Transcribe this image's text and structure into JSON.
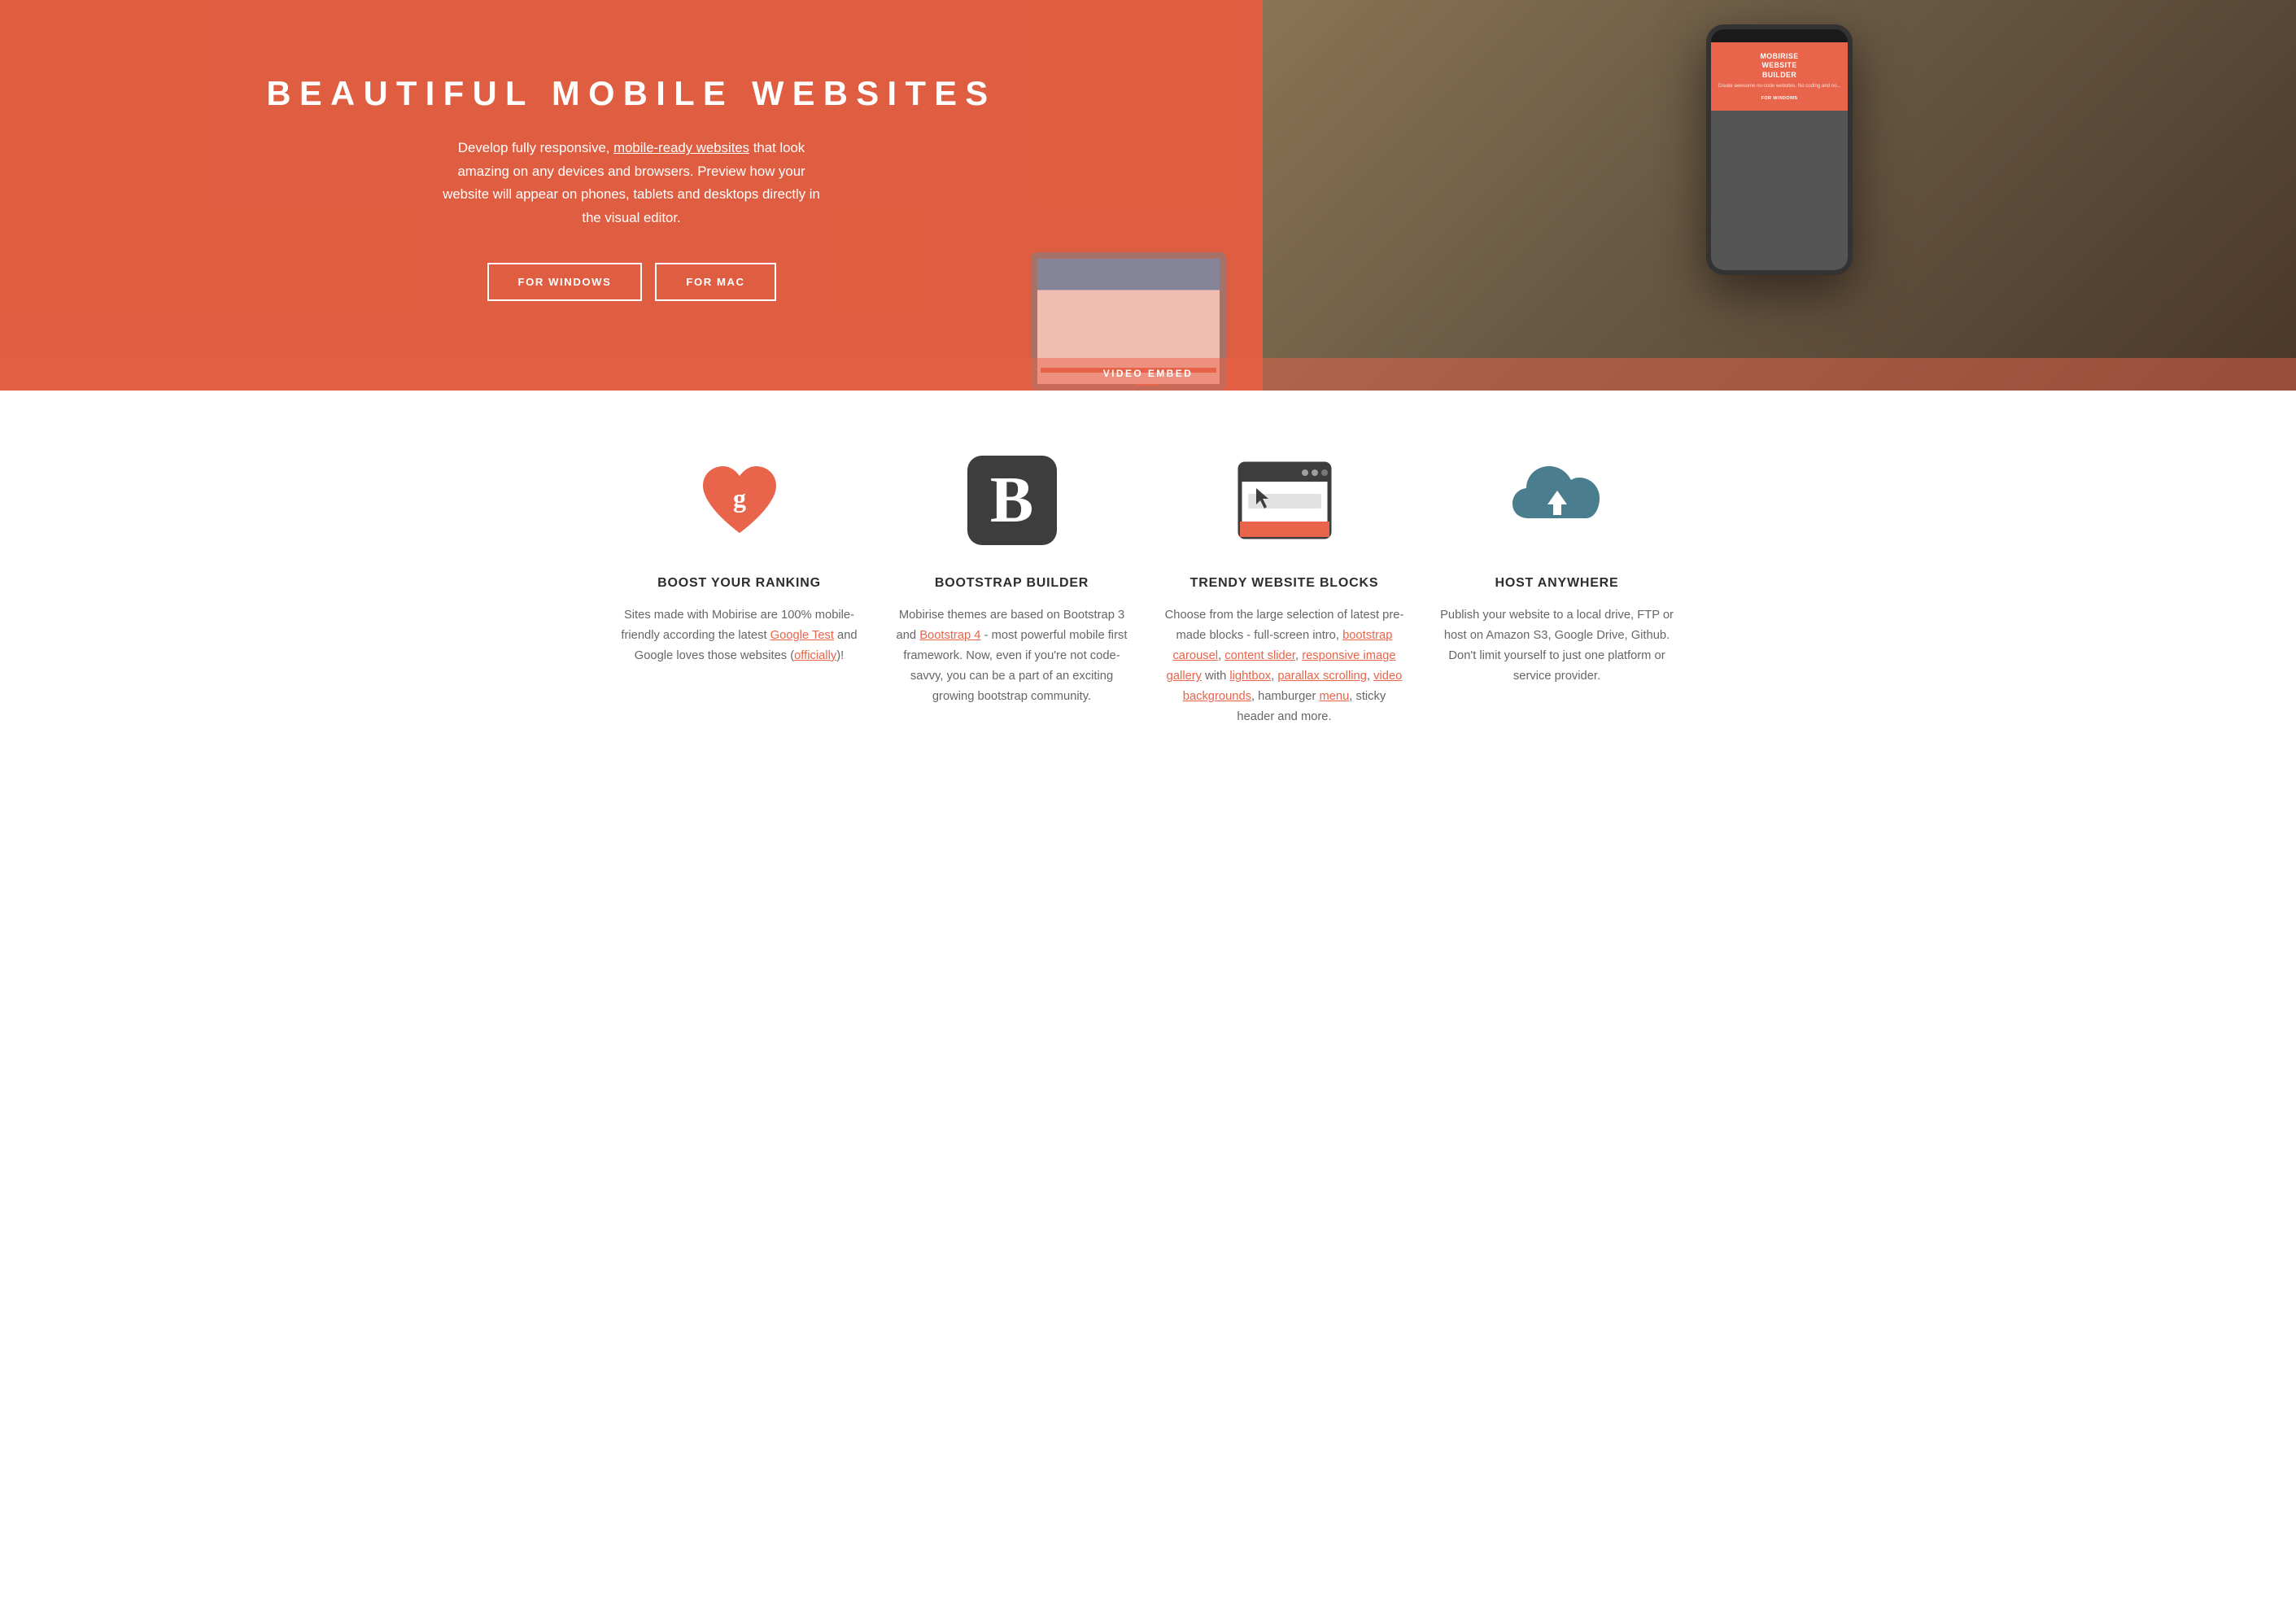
{
  "hero": {
    "title": "BEAUTIFUL MOBILE WEBSITES",
    "description_parts": [
      "Develop fully responsive, ",
      "mobile-ready websites",
      " that look amazing on any devices and browsers. Preview how your website will appear on phones, tablets and desktops directly in the visual editor."
    ],
    "description_link_text": "mobile-ready websites",
    "btn_windows": "FOR WINDOWS",
    "btn_mac": "FOR MAC",
    "phone_title": "MOBIRISE\nWEBSITE\nBUILDER",
    "phone_sub": "Create awesome no-code websites. No coding and no...",
    "phone_btn": "FOR WINDOWS",
    "video_label": "VIDEO EMBED"
  },
  "features": [
    {
      "icon": "heart-google",
      "title": "BOOST YOUR RANKING",
      "description_html": "Sites made with Mobirise are 100% mobile-friendly according the latest <u>Google Test</u> and Google loves those websites (<u>officially</u>)!"
    },
    {
      "icon": "bootstrap-b",
      "title": "BOOTSTRAP BUILDER",
      "description_html": "Mobirise themes are based on Bootstrap 3 and <u>Bootstrap 4</u> - most powerful mobile first framework. Now, even if you're not code-savvy, you can be a part of an exciting growing bootstrap community."
    },
    {
      "icon": "browser-window",
      "title": "TRENDY WEBSITE BLOCKS",
      "description_html": "Choose from the large selection of latest pre-made blocks - full-screen intro, <u>bootstrap carousel</u>, <u>content slider</u>, <u>responsive image gallery</u> with <u>lightbox</u>, <u>parallax scrolling</u>, <u>video backgrounds</u>, hamburger <u>menu</u>, sticky header and more."
    },
    {
      "icon": "cloud-upload",
      "title": "HOST ANYWHERE",
      "description_html": "Publish your website to a local drive, FTP or host on Amazon S3, Google Drive, Github. Don't limit yourself to just one platform or service provider."
    }
  ]
}
